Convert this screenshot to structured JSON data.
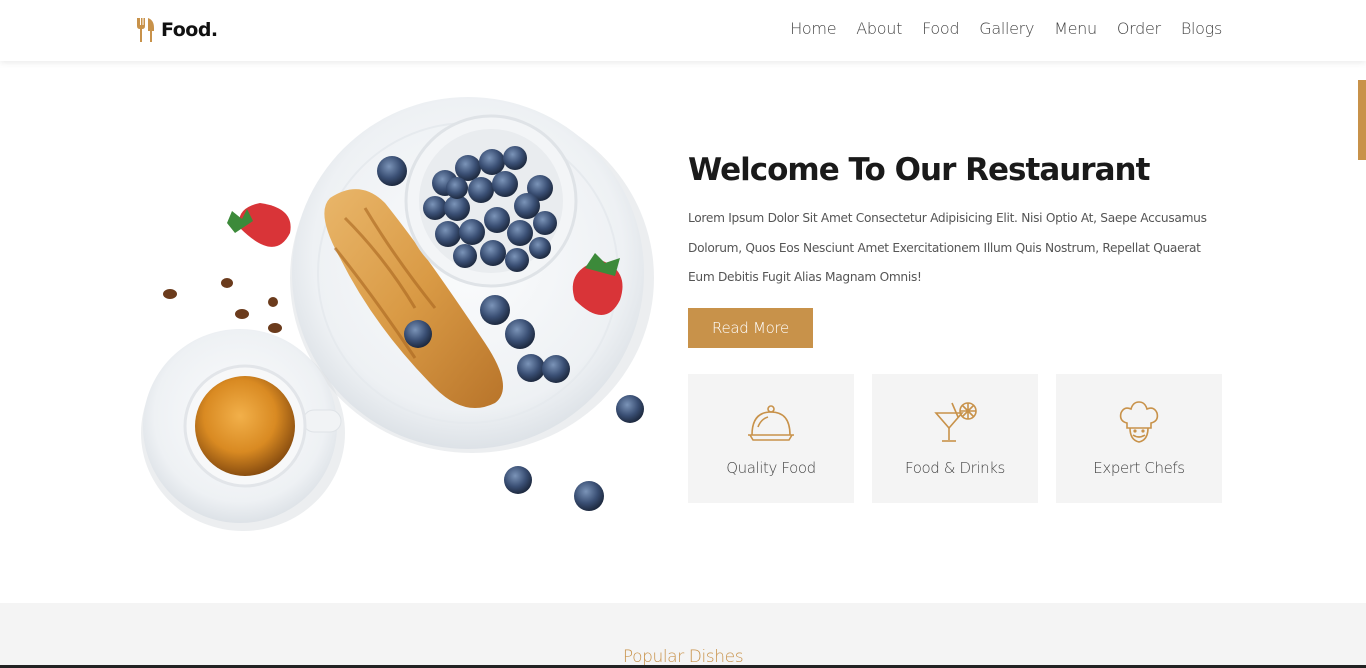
{
  "brand": {
    "name": "Food.",
    "icon": "fork-knife-icon",
    "accent_color": "#c8924a"
  },
  "nav": {
    "items": [
      "Home",
      "About",
      "Food",
      "Gallery",
      "Menu",
      "Order",
      "Blogs"
    ]
  },
  "hero": {
    "title": "Welcome To Our Restaurant",
    "body": "Lorem Ipsum Dolor Sit Amet Consectetur Adipisicing Elit. Nisi Optio At, Saepe Accusamus Dolorum, Quos Eos Nesciunt Amet Exercitationem Illum Quis Nostrum, Repellat Quaerat Eum Debitis Fugit Alias Magnam Omnis!",
    "button_label": "Read More",
    "image": "breakfast-plate-croissant-blueberries-coffee"
  },
  "features": [
    {
      "label": "Quality Food",
      "icon": "cloche-icon"
    },
    {
      "label": "Food & Drinks",
      "icon": "cocktail-icon"
    },
    {
      "label": "Expert Chefs",
      "icon": "chef-hat-icon"
    }
  ],
  "dishes": {
    "title": "Popular Dishes"
  }
}
